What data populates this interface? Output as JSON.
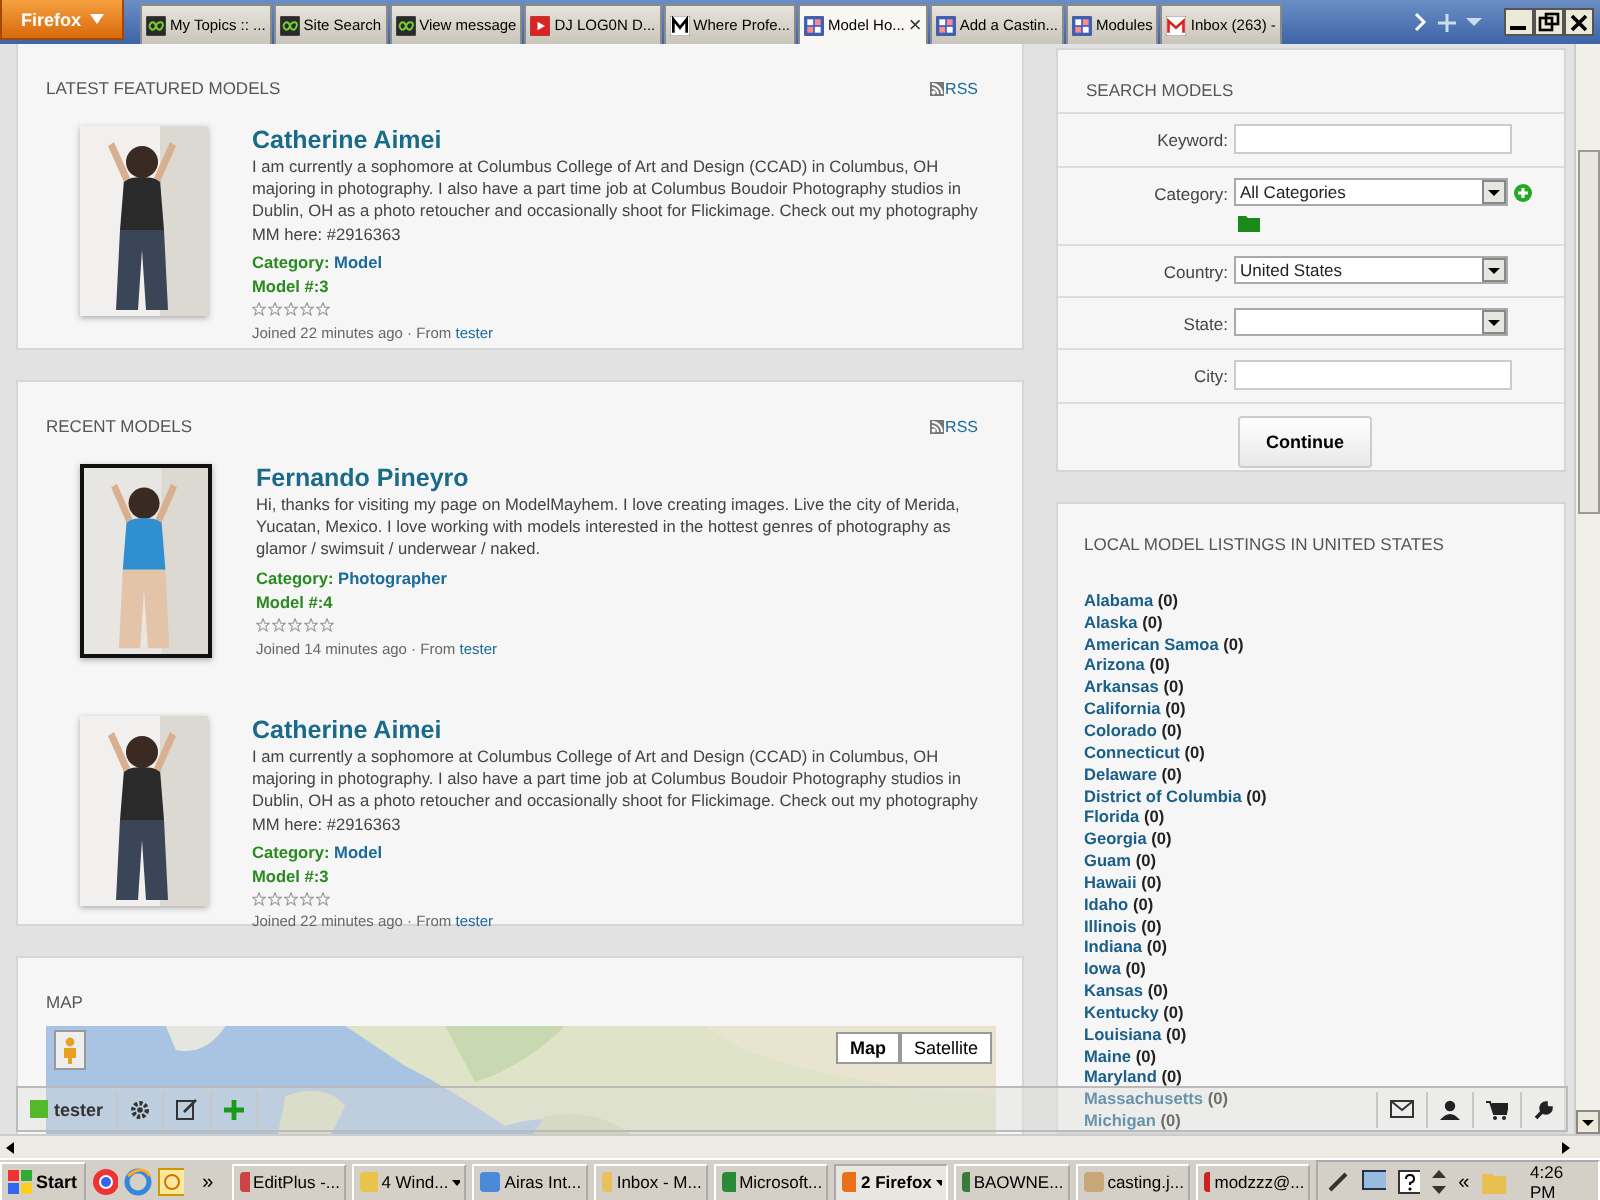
{
  "browser": {
    "menu_button": "Firefox",
    "tabs": [
      {
        "title": "My Topics :: ...",
        "selected": false
      },
      {
        "title": "Site Search",
        "selected": false
      },
      {
        "title": "View message",
        "selected": false
      },
      {
        "title": "DJ LOG0N D...",
        "selected": false
      },
      {
        "title": "Where Profe...",
        "selected": false
      },
      {
        "title": "Model Ho...",
        "selected": true,
        "close": "×"
      },
      {
        "title": "Add a Castin...",
        "selected": false
      },
      {
        "title": "Modules",
        "selected": false
      },
      {
        "title": "Inbox (263) -",
        "selected": false
      }
    ]
  },
  "featured": {
    "heading": "LATEST FEATURED MODELS",
    "rss": "RSS",
    "models": [
      {
        "name": "Catherine Aimei",
        "bio": "I am currently a sophomore at Columbus College of Art and Design (CCAD) in Columbus, OH majoring in photography. I also have a part time job at Columbus Boudoir Photography studios in Dublin, OH as a photo retoucher and occasionally shoot for Flickimage. Check out my photography MM here: #2916363",
        "category_label": "Category:",
        "category": "Model",
        "model_no": "Model #:3",
        "stars": 0,
        "joined": "Joined 22 minutes ago · From",
        "from": "tester"
      }
    ]
  },
  "recent": {
    "heading": "RECENT MODELS",
    "rss": "RSS",
    "models": [
      {
        "name": "Fernando Pineyro",
        "bio": "Hi, thanks for visiting my page on ModelMayhem. I love creating images. Live the city of Merida, Yucatan, Mexico. I love working with models interested in the hottest genres of photography as glamor / swimsuit / underwear / naked.",
        "category_label": "Category:",
        "category": "Photographer",
        "model_no": "Model #:4",
        "stars": 0,
        "joined": "Joined 14 minutes ago · From",
        "from": "tester"
      },
      {
        "name": "Catherine Aimei",
        "bio": "I am currently a sophomore at Columbus College of Art and Design (CCAD) in Columbus, OH majoring in photography. I also have a part time job at Columbus Boudoir Photography studios in Dublin, OH as a photo retoucher and occasionally shoot for Flickimage. Check out my photography MM here: #2916363",
        "category_label": "Category:",
        "category": "Model",
        "model_no": "Model #:3",
        "stars": 0,
        "joined": "Joined 22 minutes ago · From",
        "from": "tester"
      }
    ]
  },
  "map": {
    "heading": "MAP",
    "buttons": [
      {
        "label": "Map",
        "selected": true
      },
      {
        "label": "Satellite",
        "selected": false
      }
    ]
  },
  "search": {
    "heading": "SEARCH MODELS",
    "fields": [
      {
        "label": "Keyword:",
        "kind": "text"
      },
      {
        "label": "Category:",
        "kind": "select",
        "value": "All Categories",
        "extras": true
      },
      {
        "label": "Country:",
        "kind": "select",
        "value": "United States"
      },
      {
        "label": "State:",
        "kind": "select"
      },
      {
        "label": "City:",
        "kind": "text"
      }
    ],
    "submit": "Continue"
  },
  "listings": {
    "heading": "LOCAL MODEL LISTINGS IN UNITED STATES",
    "states": [
      {
        "name": "Alabama",
        "count": "(0)"
      },
      {
        "name": "Alaska",
        "count": "(0)"
      },
      {
        "name": "American Samoa",
        "count": "(0)"
      },
      {
        "name": "Arizona",
        "count": "(0)"
      },
      {
        "name": "Arkansas",
        "count": "(0)"
      },
      {
        "name": "California",
        "count": "(0)"
      },
      {
        "name": "Colorado",
        "count": "(0)"
      },
      {
        "name": "Connecticut",
        "count": "(0)"
      },
      {
        "name": "Delaware",
        "count": "(0)"
      },
      {
        "name": "District of Columbia",
        "count": "(0)"
      },
      {
        "name": "Florida",
        "count": "(0)"
      },
      {
        "name": "Georgia",
        "count": "(0)"
      },
      {
        "name": "Guam",
        "count": "(0)"
      },
      {
        "name": "Hawaii",
        "count": "(0)"
      },
      {
        "name": "Idaho",
        "count": "(0)"
      },
      {
        "name": "Illinois",
        "count": "(0)"
      },
      {
        "name": "Indiana",
        "count": "(0)"
      },
      {
        "name": "Iowa",
        "count": "(0)"
      },
      {
        "name": "Kansas",
        "count": "(0)"
      },
      {
        "name": "Kentucky",
        "count": "(0)"
      },
      {
        "name": "Louisiana",
        "count": "(0)"
      },
      {
        "name": "Maine",
        "count": "(0)"
      },
      {
        "name": "Maryland",
        "count": "(0)"
      },
      {
        "name": "Massachusetts",
        "count": "(0)"
      },
      {
        "name": "Michigan",
        "count": "(0)"
      }
    ]
  },
  "toolbar": {
    "user": "tester"
  },
  "taskbar": {
    "start": "Start",
    "more": "»",
    "items": [
      {
        "label": "EditPlus -...",
        "selected": false
      },
      {
        "label": "4 Wind...",
        "selected": false,
        "menu": true
      },
      {
        "label": "Airas Int...",
        "selected": false
      },
      {
        "label": "Inbox - M...",
        "selected": false
      },
      {
        "label": "Microsoft...",
        "selected": false
      },
      {
        "label": "2 Firefox",
        "selected": true,
        "menu": true
      },
      {
        "label": "BAOWNE...",
        "selected": false
      },
      {
        "label": "casting.j...",
        "selected": false
      },
      {
        "label": "modzzz@...",
        "selected": false
      }
    ],
    "tray_toggle": "«",
    "clock": "4:26 PM"
  }
}
